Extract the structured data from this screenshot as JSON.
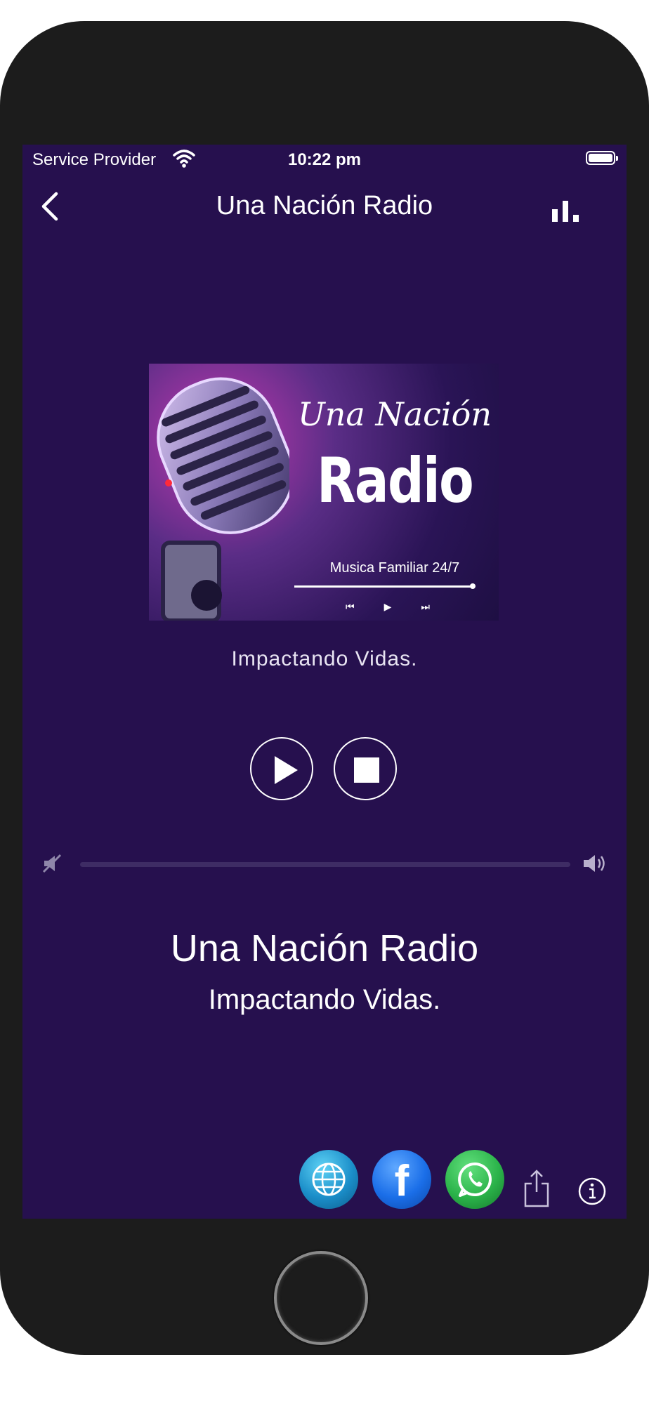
{
  "status_bar": {
    "carrier": "Service Provider",
    "time": "10:22 pm",
    "wifi_icon": "wifi-icon",
    "battery_icon": "battery-icon"
  },
  "navbar": {
    "title": "Una Nación Radio",
    "back_icon": "chevron-left-icon",
    "right_icon": "equalizer-bars-icon"
  },
  "cover_art": {
    "script_text": "Una Nación",
    "big_text": "Radio",
    "tagline": "Musica Familiar 24/7",
    "controls": [
      "⏮",
      "▶",
      "⏭"
    ]
  },
  "now_playing": {
    "subtitle": "Impactando Vidas."
  },
  "controls": {
    "play_icon": "play-icon",
    "stop_icon": "stop-icon"
  },
  "volume": {
    "level": 0,
    "min_icon": "volume-mute-icon",
    "max_icon": "volume-high-icon"
  },
  "station": {
    "name": "Una Nación Radio",
    "slogan": "Impactando Vidas."
  },
  "footer": {
    "social": [
      "globe-icon",
      "facebook-icon",
      "whatsapp-icon"
    ],
    "facebook_glyph": "f",
    "share_icon": "share-icon",
    "info_icon": "info-icon"
  },
  "colors": {
    "screen_background": "#26104e",
    "device_body": "#1c1c1c"
  }
}
